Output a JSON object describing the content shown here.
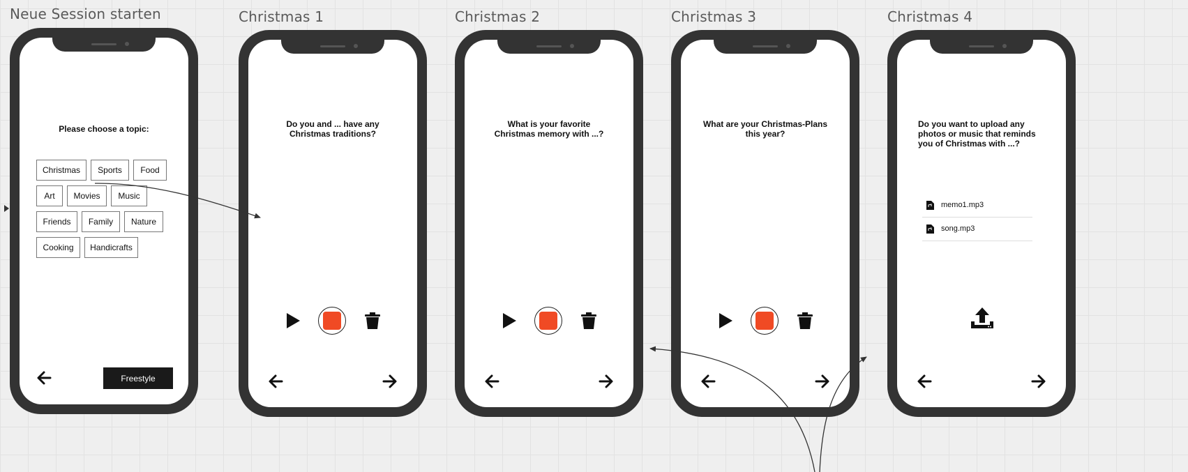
{
  "frames": [
    {
      "title": "Neue Session starten"
    },
    {
      "title": "Christmas 1",
      "question": "Do you and ... have any\nChristmas traditions?"
    },
    {
      "title": "Christmas 2",
      "question": "What is your favorite\nChristmas memory with ...?"
    },
    {
      "title": "Christmas 3",
      "question": "What are your Christmas-Plans\nthis year?"
    },
    {
      "title": "Christmas 4",
      "question": "Do you want to upload any\nphotos or music that reminds\nyou of Christmas with ...?"
    }
  ],
  "topic_screen": {
    "prompt": "Please choose a topic:",
    "topics": [
      "Christmas",
      "Sports",
      "Food",
      "Art",
      "Movies",
      "Music",
      "Friends",
      "Family",
      "Nature",
      "Cooking",
      "Handicrafts"
    ],
    "freestyle_label": "Freestyle"
  },
  "files": [
    "memo1.mp3",
    "song.mp3"
  ],
  "icons": {
    "play": "play-icon",
    "record": "record-icon",
    "delete": "trash-icon",
    "back": "arrow-left-icon",
    "next": "arrow-right-icon",
    "upload": "upload-icon",
    "file": "audio-file-icon"
  },
  "colors": {
    "record": "#f04a24",
    "phone_frame": "#333333",
    "button_dark": "#1a1a1a"
  }
}
